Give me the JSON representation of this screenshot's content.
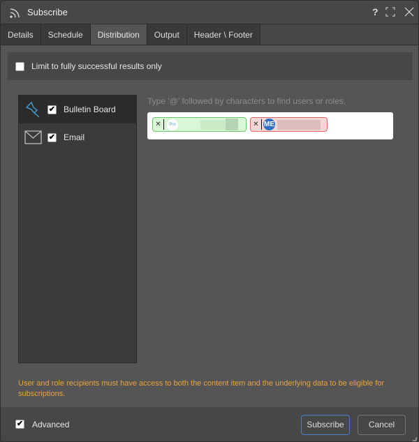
{
  "title": "Subscribe",
  "controls": {
    "help": "?",
    "maximize": "⛶",
    "close": "✕"
  },
  "tabs": [
    {
      "label": "Details"
    },
    {
      "label": "Schedule"
    },
    {
      "label": "Distribution",
      "active": true
    },
    {
      "label": "Output"
    },
    {
      "label": "Header \\ Footer"
    }
  ],
  "limit": {
    "label": "Limit to fully successful results only",
    "checked": false
  },
  "channels": [
    {
      "label": "Bulletin Board",
      "icon": "pin-icon",
      "checked": true,
      "selected": true
    },
    {
      "label": "Email",
      "icon": "envelope-icon",
      "checked": true
    }
  ],
  "recipients": {
    "hint": "Type '@' followed by characters to find users or roles.",
    "chips": [
      {
        "avatar": "Pro",
        "color": "#d9f7d6",
        "border": "#6cc46a"
      },
      {
        "avatar": "ME",
        "color": "#f3d6d6",
        "border": "#e06666"
      }
    ]
  },
  "warning": "User and role recipients must have access to both the content item and the underlying data to be eligible for subscriptions.",
  "footer": {
    "advanced": "Advanced",
    "advanced_checked": true,
    "subscribe": "Subscribe",
    "cancel": "Cancel"
  },
  "colors": {
    "accent": "#4a7fd4",
    "warning": "#e8a33d"
  }
}
